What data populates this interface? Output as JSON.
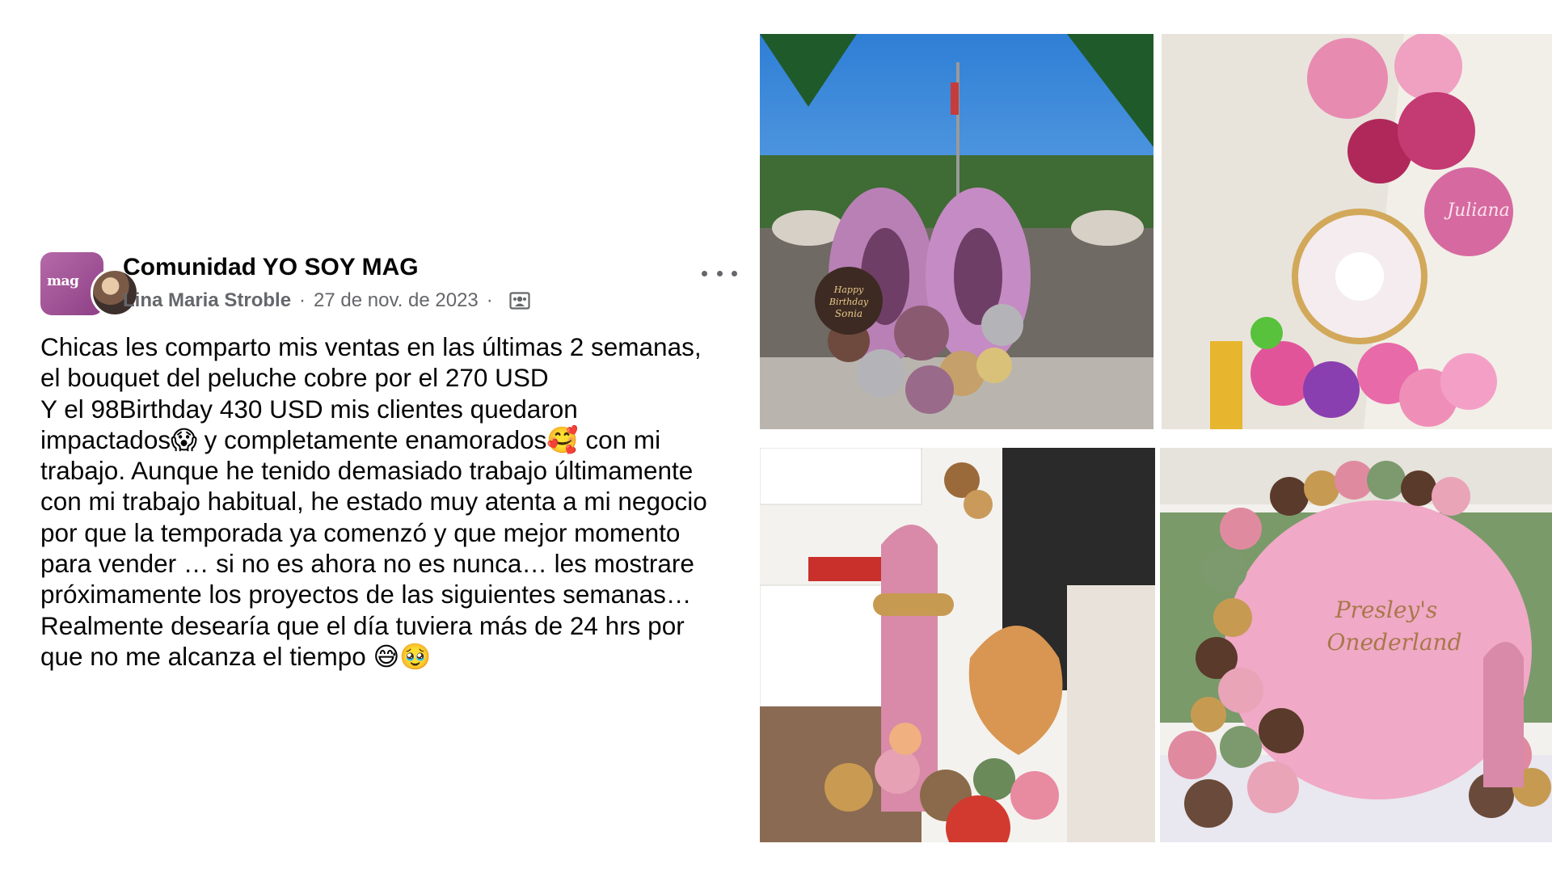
{
  "post": {
    "group_name": "Comunidad YO SOY MAG",
    "group_avatar_text": "mag",
    "author": "Lina Maria Stroble",
    "separator": "·",
    "date": "27 de nov. de 2023",
    "audience_icon": "group-members-icon",
    "more_icon": "more-options-icon",
    "body": "Chicas les comparto mis  ventas en las últimas 2 semanas,\nel bouquet del peluche cobre por el 270 USD\nY el 98Birthday 430 USD mis clientes quedaron\nimpactados😱 y completamente enamorados🥰 con mi\ntrabajo. Aunque he tenido demasiado trabajo últimamente\ncon mi trabajo habitual, he estado muy atenta a mi negocio\npor que la temporada ya comenzó y que mejor momento\npara vender … si no es ahora no es nunca… les mostrare\npróximamente los proyectos de las siguientes semanas…\nRealmente desearía que el día tuviera más de 24 hrs por\nque no me alcanza el tiempo 😅🥹"
  },
  "photos": {
    "p1_balloon_text": "Happy Birthday Sonia",
    "p2_balloon_text": "Juliana",
    "p4_backdrop_text_1": "Presley's",
    "p4_backdrop_text_2": "Onederland"
  },
  "colors": {
    "text_primary": "#050505",
    "text_secondary": "#65676b",
    "brand_purple": "#9c4f95"
  }
}
